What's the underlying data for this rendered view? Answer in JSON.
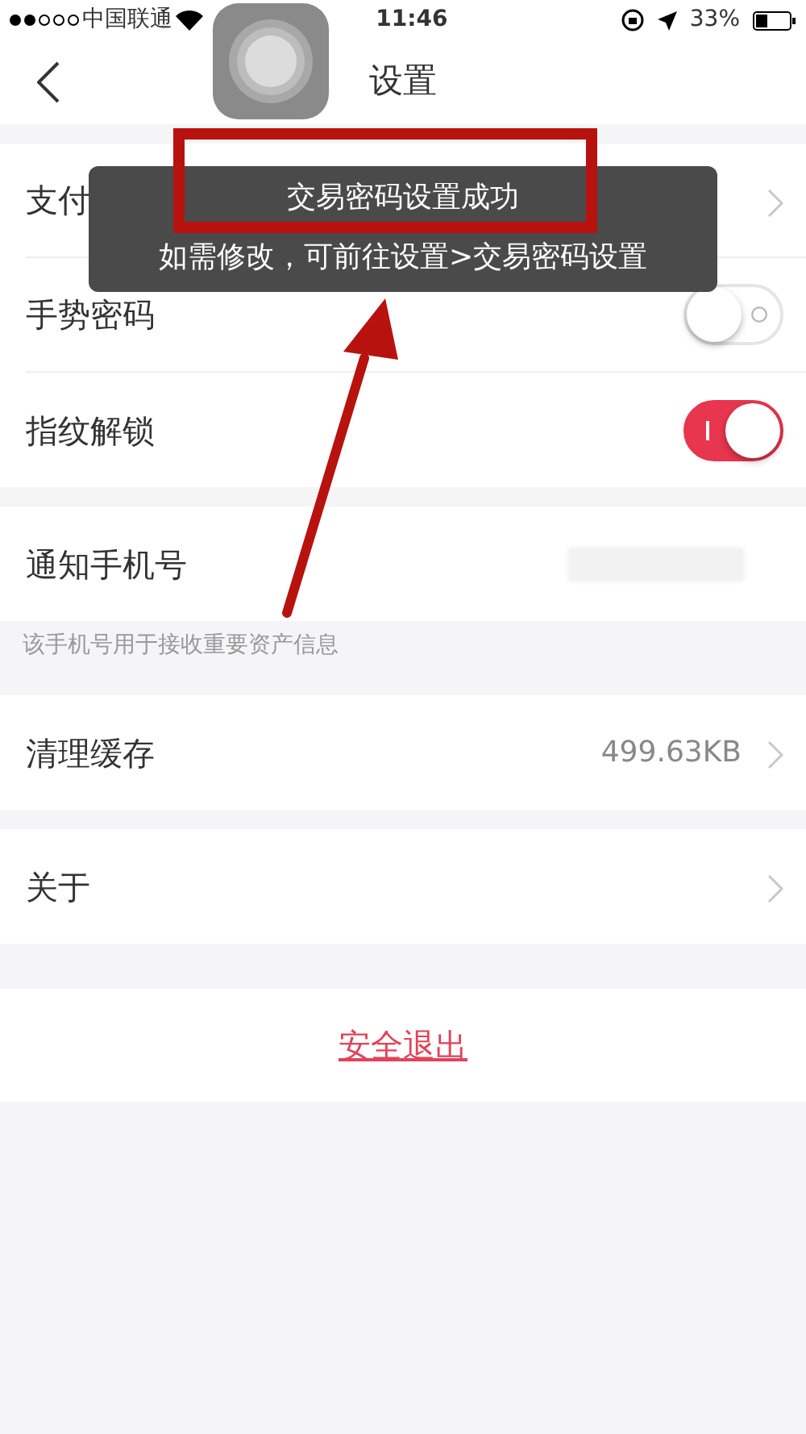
{
  "status_bar": {
    "carrier": "中国联通",
    "time": "11:46",
    "battery": "33%"
  },
  "nav": {
    "title": "设置"
  },
  "groups": [
    {
      "rows": [
        {
          "kind": "link",
          "label": "支付"
        },
        {
          "kind": "toggle",
          "label": "手势密码",
          "on": false
        },
        {
          "kind": "toggle",
          "label": "指纹解锁",
          "on": true
        }
      ]
    },
    {
      "rows": [
        {
          "kind": "masked",
          "label": "通知手机号"
        }
      ],
      "footer": "该手机号用于接收重要资产信息"
    },
    {
      "rows": [
        {
          "kind": "link",
          "label": "清理缓存",
          "value": "499.63KB"
        }
      ]
    },
    {
      "rows": [
        {
          "kind": "link",
          "label": "关于"
        }
      ]
    }
  ],
  "logout": "安全退出",
  "toast": {
    "title": "交易密码设置成功",
    "message": "如需修改，可前往设置>交易密码设置"
  }
}
